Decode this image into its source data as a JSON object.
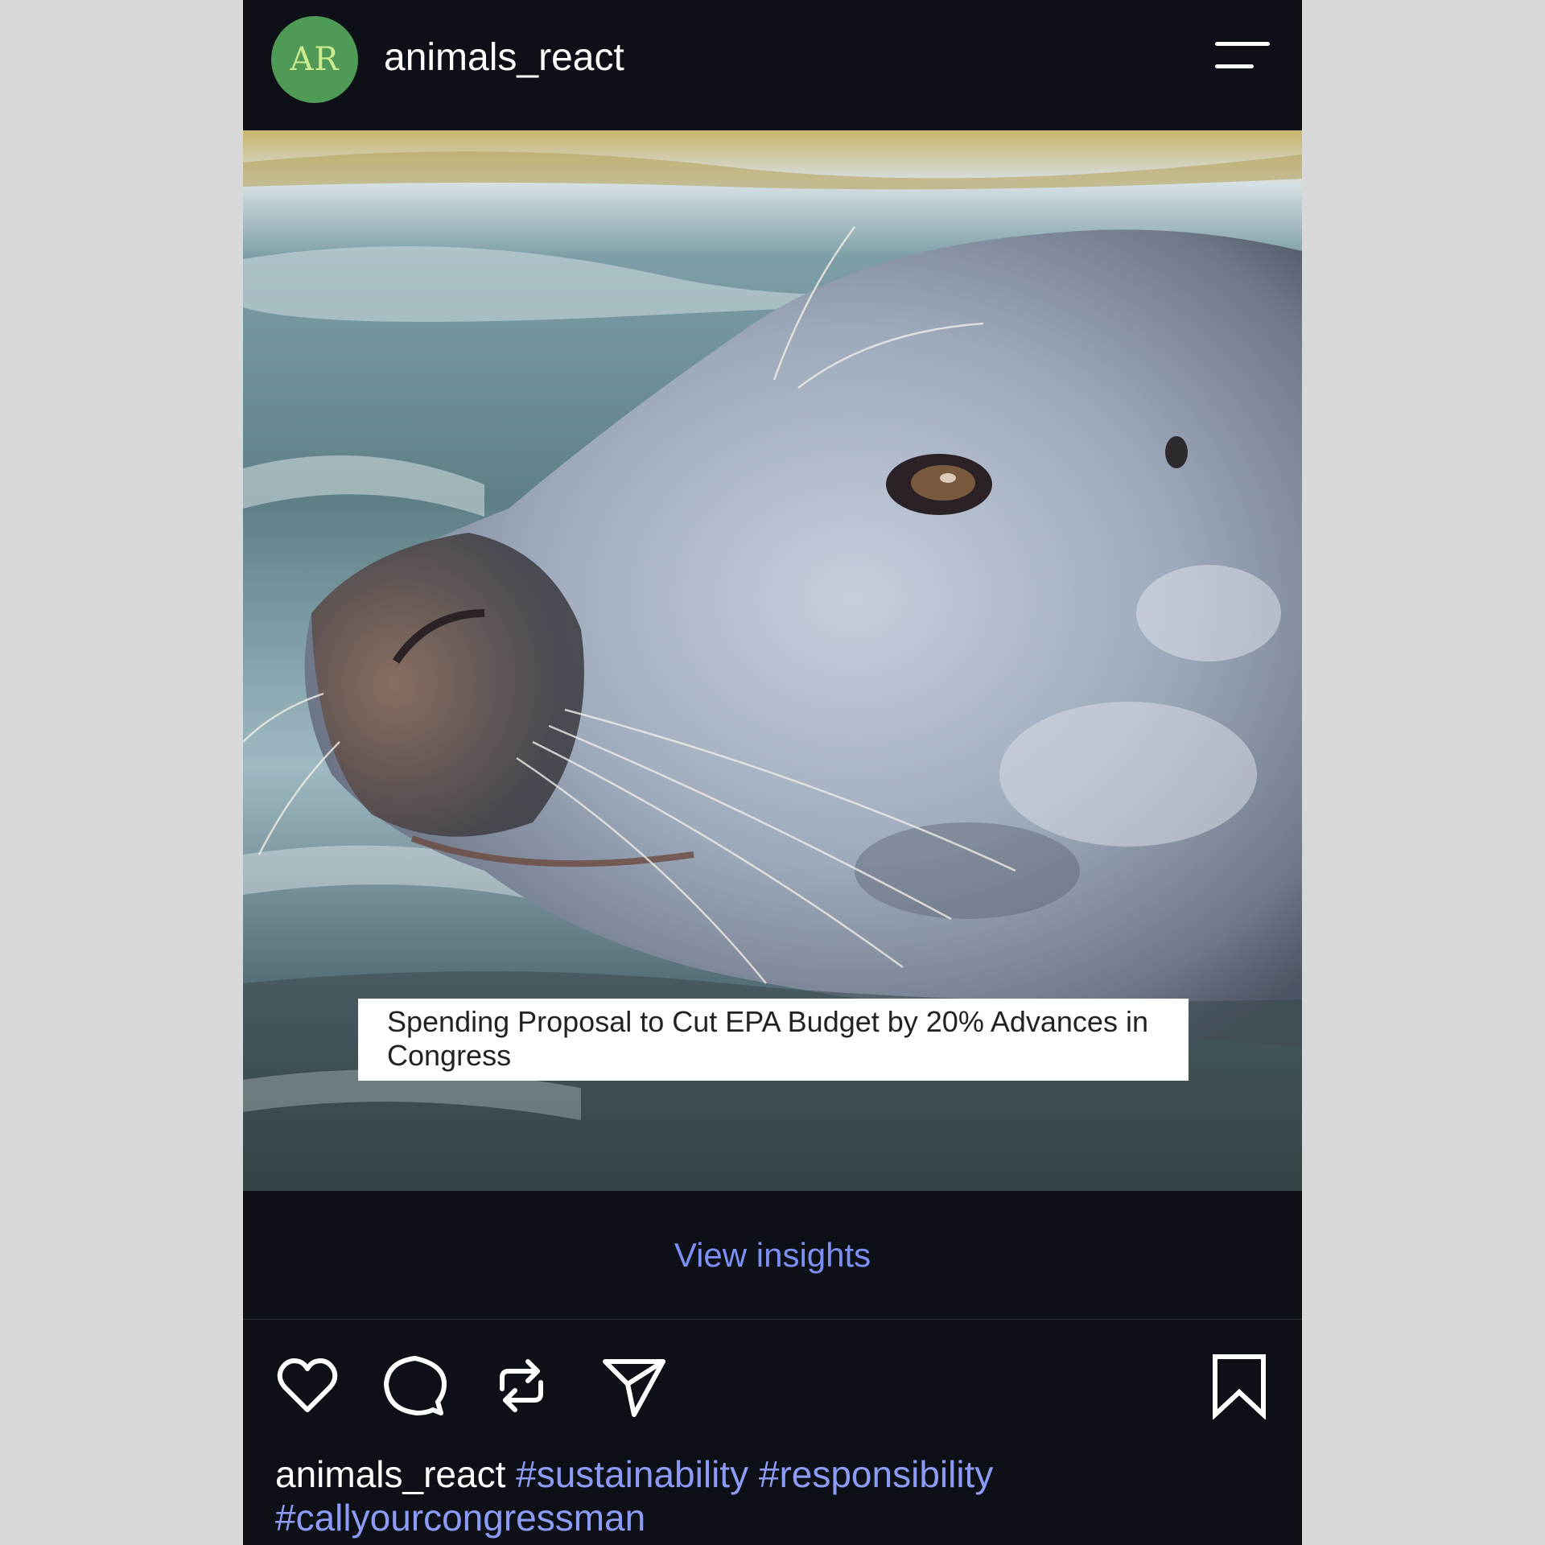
{
  "header": {
    "avatar_initials": "AR",
    "username": "animals_react"
  },
  "post": {
    "image_subject": "grey seal head above water",
    "headline": "Spending Proposal to Cut EPA Budget by 20% Advances in Congress",
    "insights_label": "View insights"
  },
  "actions": {
    "icons": [
      "heart-icon",
      "comment-icon",
      "repost-icon",
      "send-icon",
      "bookmark-icon"
    ]
  },
  "caption": {
    "username": "animals_react",
    "tags": [
      "#sustainability",
      "#responsibility",
      "#callyourcongressman"
    ]
  },
  "colors": {
    "background": "#0d1117",
    "link": "#7c8ff5",
    "avatar": "#4f9a57"
  }
}
